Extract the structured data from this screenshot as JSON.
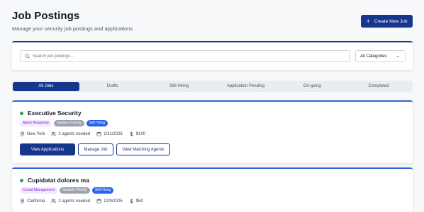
{
  "header": {
    "title": "Job Postings",
    "subtitle": "Manage your security job postings and applications",
    "create_label": "Create New Job"
  },
  "search": {
    "placeholder": "Search job postings...",
    "category_value": "All Categories"
  },
  "tabs": [
    "All Jobs",
    "Drafts",
    "Still Hiring",
    "Application Pending",
    "On-going",
    "Completed"
  ],
  "active_tab": "All Jobs",
  "jobs": [
    {
      "title": "Executive Security",
      "category": "Alarm Response",
      "priority": "medium Priority",
      "status": "Still Hiring",
      "location": "New York",
      "agents": "2 agents needed",
      "date": "1/31/2026",
      "price": "$100",
      "actions": [
        "View Applications",
        "Manage Job",
        "View Matching Agents"
      ]
    },
    {
      "title": "Cupidatat dolores ma",
      "category": "Crowd Management",
      "priority": "medium Priority",
      "status": "Still Hiring",
      "location": "California",
      "agents": "2 agents needed",
      "date": "12/9/2025",
      "price": "$50"
    }
  ],
  "colors": {
    "primary": "#16358d",
    "status_dot": "#22a55b",
    "status_badge": "#2563eb",
    "category_badge_bg": "#f3e8ff",
    "category_badge_text": "#7e22ce",
    "priority_badge": "#9ca3af"
  },
  "icons": [
    "plus-icon",
    "search-icon",
    "chevron-down-icon",
    "map-pin-icon",
    "users-icon",
    "calendar-icon",
    "dollar-icon"
  ]
}
